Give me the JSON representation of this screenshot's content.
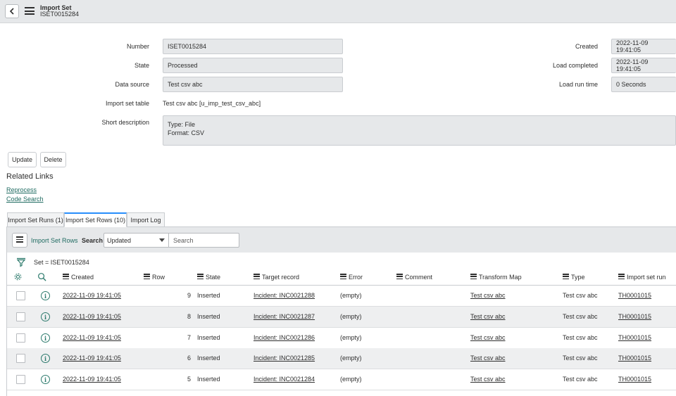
{
  "header": {
    "title": "Import Set",
    "subtitle": "ISET0015284"
  },
  "form": {
    "number_label": "Number",
    "number_value": "ISET0015284",
    "state_label": "State",
    "state_value": "Processed",
    "data_source_label": "Data source",
    "data_source_value": "Test csv abc",
    "import_set_table_label": "Import set table",
    "import_set_table_value": "Test csv abc [u_imp_test_csv_abc]",
    "short_description_label": "Short description",
    "short_description_line1": "Type: File",
    "short_description_line2": "Format: CSV",
    "created_label": "Created",
    "created_value": "2022-11-09 19:41:05",
    "load_completed_label": "Load completed",
    "load_completed_value": "2022-11-09 19:41:05",
    "load_run_time_label": "Load run time",
    "load_run_time_value": "0 Seconds"
  },
  "buttons": {
    "update": "Update",
    "delete": "Delete"
  },
  "related_links": {
    "title": "Related Links",
    "reprocess": "Reprocess",
    "code_search": "Code Search"
  },
  "tabs": [
    {
      "label": "Import Set Runs (1)"
    },
    {
      "label": "Import Set Rows (10)"
    },
    {
      "label": "Import Log"
    }
  ],
  "list": {
    "title": "Import Set Rows",
    "search_label": "Search",
    "search_field": "Updated",
    "search_placeholder": "Search",
    "filter": "Set = ISET0015284",
    "columns": [
      "Created",
      "Row",
      "State",
      "Target record",
      "Error",
      "Comment",
      "Transform Map",
      "Type",
      "Import set run"
    ],
    "rows": [
      {
        "created": "2022-11-09 19:41:05",
        "row": "9",
        "state": "Inserted",
        "target": "Incident: INC0021288",
        "error": "(empty)",
        "comment": "",
        "transform_map": "Test csv abc",
        "type": "Test csv abc",
        "run": "TH0001015"
      },
      {
        "created": "2022-11-09 19:41:05",
        "row": "8",
        "state": "Inserted",
        "target": "Incident: INC0021287",
        "error": "(empty)",
        "comment": "",
        "transform_map": "Test csv abc",
        "type": "Test csv abc",
        "run": "TH0001015"
      },
      {
        "created": "2022-11-09 19:41:05",
        "row": "7",
        "state": "Inserted",
        "target": "Incident: INC0021286",
        "error": "(empty)",
        "comment": "",
        "transform_map": "Test csv abc",
        "type": "Test csv abc",
        "run": "TH0001015"
      },
      {
        "created": "2022-11-09 19:41:05",
        "row": "6",
        "state": "Inserted",
        "target": "Incident: INC0021285",
        "error": "(empty)",
        "comment": "",
        "transform_map": "Test csv abc",
        "type": "Test csv abc",
        "run": "TH0001015"
      },
      {
        "created": "2022-11-09 19:41:05",
        "row": "5",
        "state": "Inserted",
        "target": "Incident: INC0021284",
        "error": "(empty)",
        "comment": "",
        "transform_map": "Test csv abc",
        "type": "Test csv abc",
        "run": "TH0001015"
      }
    ]
  },
  "colors": {
    "link_green": "#1f6b61",
    "tab_accent": "#278efc",
    "header_bg": "#e6e8ea"
  }
}
